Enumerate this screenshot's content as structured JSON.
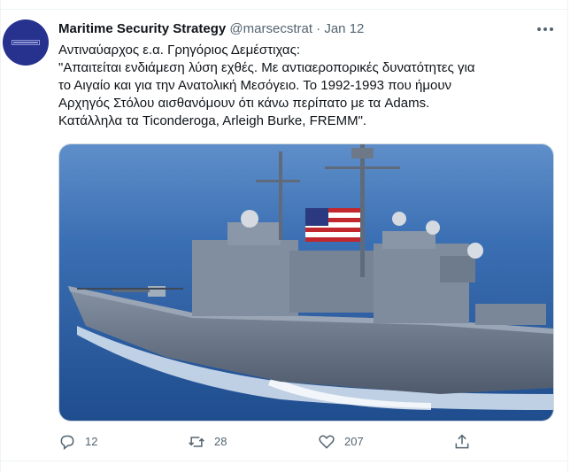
{
  "tweet": {
    "author": {
      "name": "Maritime Security Strategy",
      "handle": "@marsecstrat",
      "separator": "·",
      "date": "Jan 12",
      "avatar_icon": "maritime-security-logo-icon"
    },
    "text_lines": [
      "Αντιναύαρχος ε.α. Γρηγόριος Δεμέστιχας:",
      "\"Απαιτείται ενδιάμεση λύση εχθές. Με αντιαεροπορικές δυνατότητες για",
      "το Αιγαίο και για την Ανατολική Μεσόγειο. Το 1992-1993 που ήμουν",
      "Αρχηγός Στόλου αισθανόμουν ότι κάνω περίπατο με τα Adams.",
      "Κατάλληλα τα Ticonderoga, Arleigh Burke, FREMM\"."
    ],
    "media": {
      "subject": "warship-photo"
    },
    "actions": {
      "replies": "12",
      "retweets": "28",
      "likes": "207",
      "reply_icon": "reply-icon",
      "retweet_icon": "retweet-icon",
      "like_icon": "heart-icon",
      "share_icon": "share-icon"
    },
    "more_icon": "more-icon"
  },
  "colors": {
    "text": "#0f1419",
    "muted": "#536471",
    "avatar_bg": "#27318e",
    "sea": "#2a5a9e",
    "ship_hull": "#6e7b8e"
  }
}
